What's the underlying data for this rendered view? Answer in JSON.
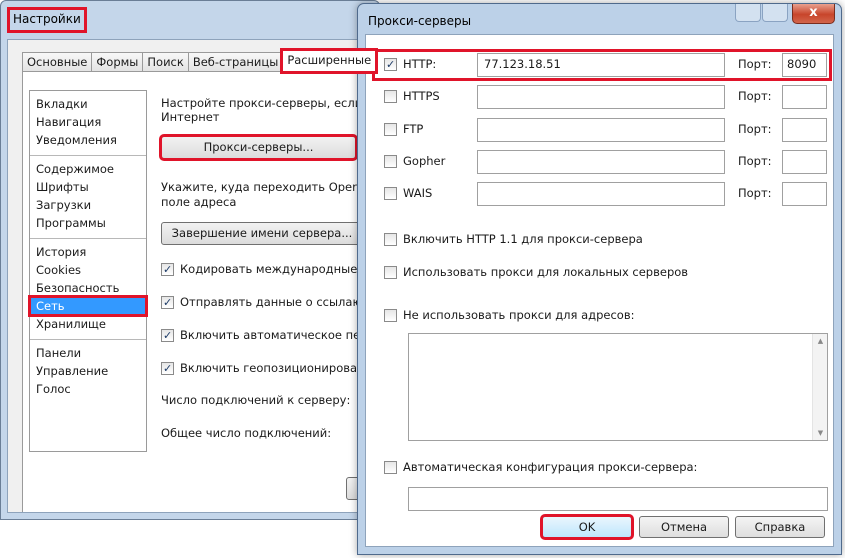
{
  "settings": {
    "title": "Настройки",
    "tabs": [
      "Основные",
      "Формы",
      "Поиск",
      "Веб-страницы",
      "Расширенные"
    ],
    "categories": {
      "group1": [
        "Вкладки",
        "Навигация",
        "Уведомления"
      ],
      "group2": [
        "Содержимое",
        "Шрифты",
        "Загрузки",
        "Программы"
      ],
      "group3": [
        "История",
        "Cookies",
        "Безопасность",
        "Сеть",
        "Хранилище"
      ],
      "group4": [
        "Панели",
        "Управление",
        "Голос"
      ]
    },
    "network": {
      "proxy_text_1": "Настройте прокси-серверы, если не",
      "proxy_text_2": "Интернет",
      "proxy_button": "Прокси-серверы...",
      "redirect_text_1": "Укажите, куда переходить Opera при",
      "redirect_text_2": "поле адреса",
      "completion_button": "Завершение имени сервера...",
      "options": [
        {
          "label": "Кодировать международные веб-",
          "checked": true
        },
        {
          "label": "Отправлять данные о ссылающе",
          "checked": true
        },
        {
          "label": "Включить автоматическое перен",
          "checked": true
        },
        {
          "label": "Включить геопозиционировани",
          "checked": true
        }
      ],
      "connections_per_server": "Число подключений к серверу:",
      "total_connections": "Общее число подключений:"
    }
  },
  "proxy_dialog": {
    "title": "Прокси-серверы",
    "close_symbol": "x",
    "port_label": "Порт:",
    "protocols": [
      {
        "name": "HTTP:",
        "checked": true,
        "host": "77.123.18.51",
        "port": "8090"
      },
      {
        "name": "HTTPS",
        "checked": false,
        "host": "",
        "port": ""
      },
      {
        "name": "FTP",
        "checked": false,
        "host": "",
        "port": ""
      },
      {
        "name": "Gopher",
        "checked": false,
        "host": "",
        "port": ""
      },
      {
        "name": "WAIS",
        "checked": false,
        "host": "",
        "port": ""
      }
    ],
    "enable_http11": {
      "label": "Включить HTTP 1.1 для прокси-сервера",
      "checked": false
    },
    "use_for_local": {
      "label": "Использовать прокси для локальных серверов",
      "checked": false
    },
    "no_proxy_for": {
      "label": "Не использовать прокси для адресов:",
      "checked": false
    },
    "auto_config": {
      "label": "Автоматическая конфигурация прокси-сервера:",
      "checked": false
    },
    "buttons": {
      "ok": "OK",
      "cancel": "Отмена",
      "help": "Справка"
    }
  },
  "colors": {
    "highlight": "#e0142a",
    "selection": "#3399ff"
  }
}
